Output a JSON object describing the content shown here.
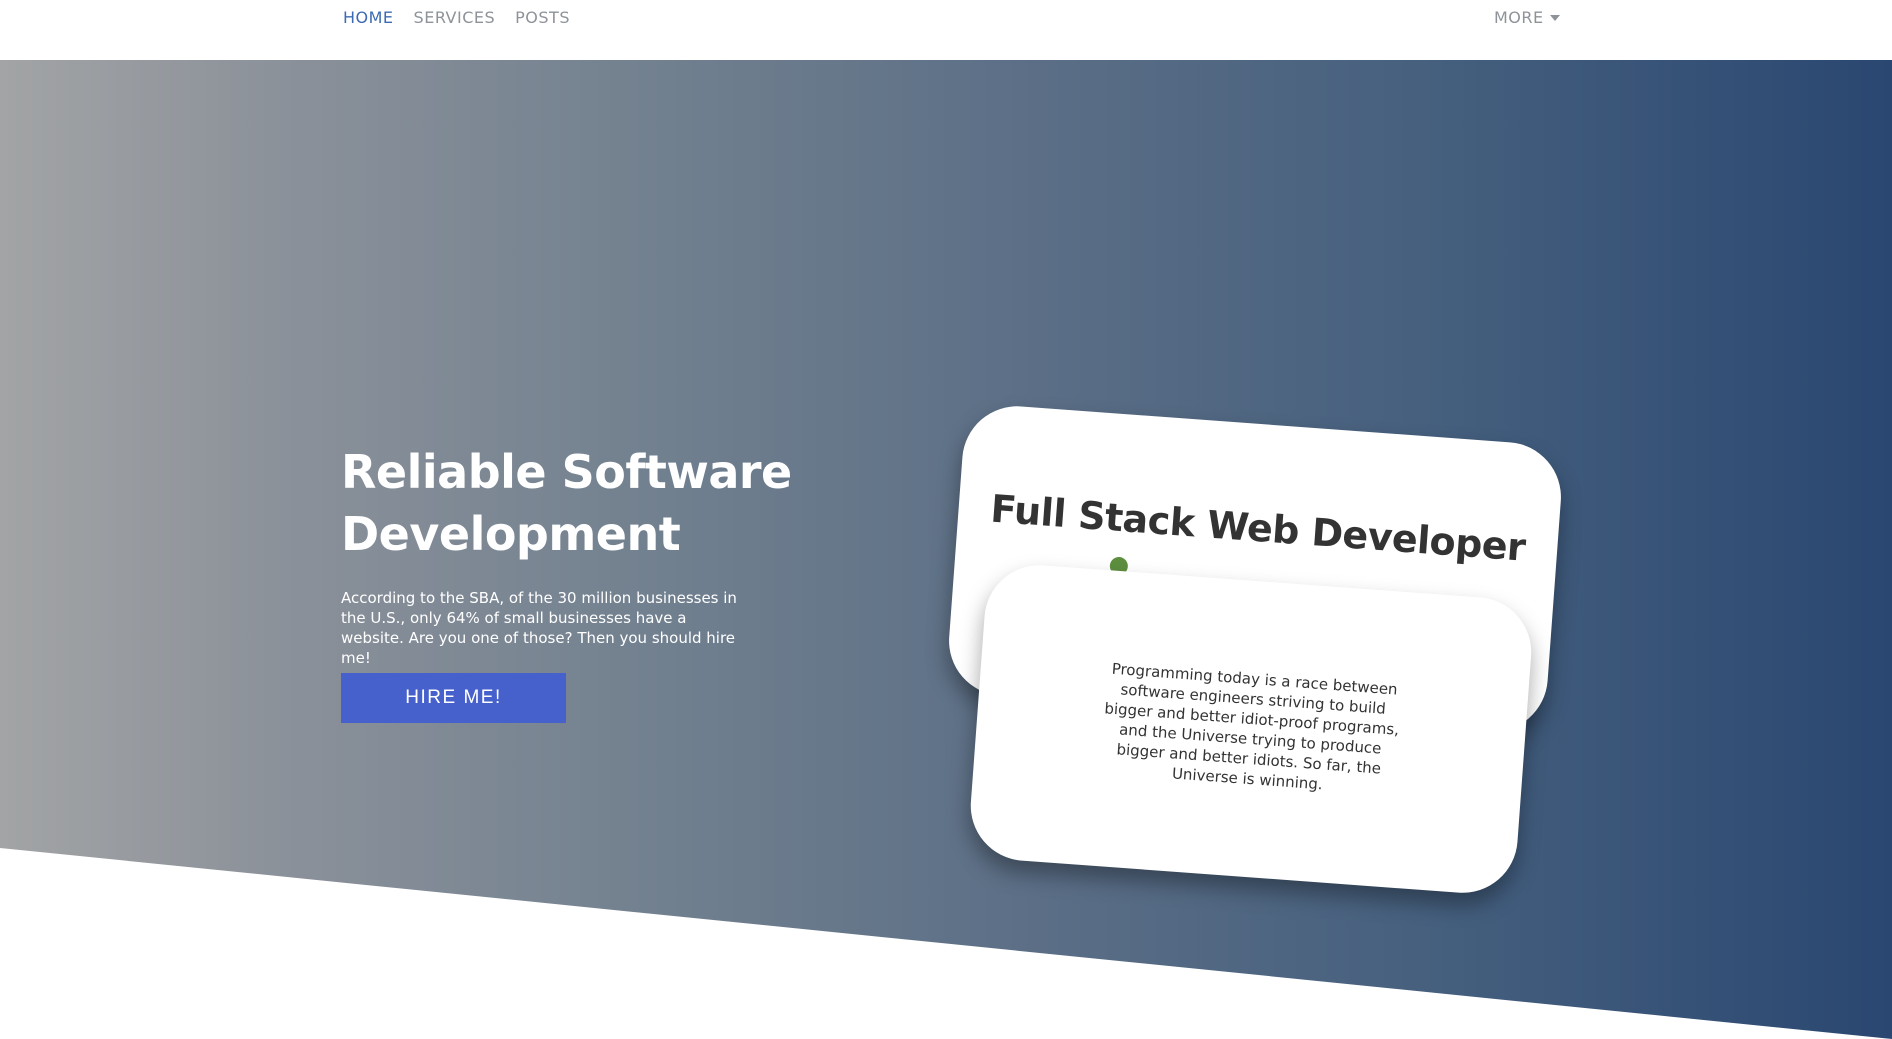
{
  "nav": {
    "items": [
      {
        "label": "HOME",
        "active": true
      },
      {
        "label": "SERVICES",
        "active": false
      },
      {
        "label": "POSTS",
        "active": false
      }
    ],
    "more_label": "MORE",
    "active_color": "#3d6bb3",
    "inactive_color": "#8e9399"
  },
  "hero": {
    "title": "Reliable Software Development",
    "description": "According to the SBA, of the 30 million businesses in the U.S., only 64% of small businesses have a website. Are you one of those? Then you should hire me!",
    "cta_label": "HIRE ME!",
    "cta_color": "#4661cc",
    "gradient_start": "#a2a4a5",
    "gradient_end": "#2a4771"
  },
  "cards": {
    "back_title": "Full Stack Web Developer",
    "front_quote": "Programming today is a race between software engineers striving to build bigger and better idiot-proof programs, and the Universe trying to produce bigger and better idiots. So far, the Universe is winning."
  }
}
